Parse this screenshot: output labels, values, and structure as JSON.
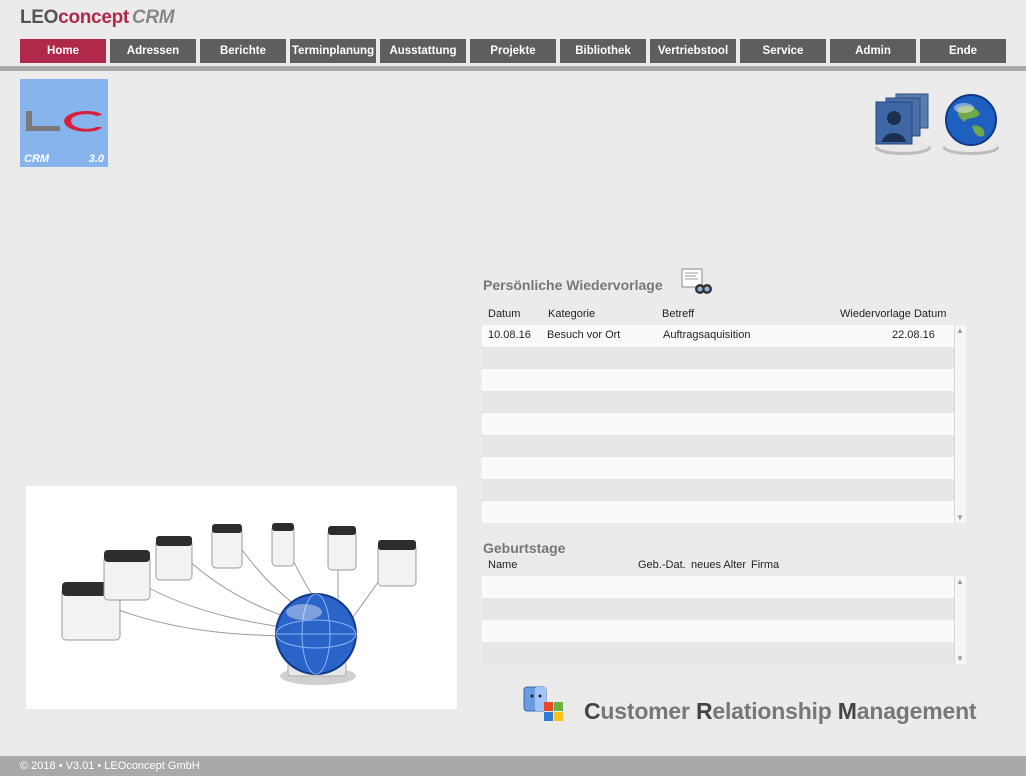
{
  "brand": {
    "part1": "LEO",
    "part2": "concept",
    "part3": "CRM"
  },
  "nav": [
    {
      "label": "Home",
      "active": true
    },
    {
      "label": "Adressen"
    },
    {
      "label": "Berichte"
    },
    {
      "label": "Terminplanung"
    },
    {
      "label": "Ausstattung"
    },
    {
      "label": "Projekte"
    },
    {
      "label": "Bibliothek"
    },
    {
      "label": "Vertriebstool"
    },
    {
      "label": "Service"
    },
    {
      "label": "Admin"
    },
    {
      "label": "Ende"
    }
  ],
  "logo": {
    "crm": "CRM",
    "version": "3.0"
  },
  "wiedervorlage": {
    "title": "Persönliche Wiedervorlage",
    "columns": {
      "datum": "Datum",
      "kategorie": "Kategorie",
      "betreff": "Betreff",
      "wv_datum": "Wiedervorlage Datum"
    },
    "rows": [
      {
        "datum": "10.08.16",
        "kategorie": "Besuch vor Ort",
        "betreff": "Auftragsaquisition",
        "wv_datum": "22.08.16"
      }
    ]
  },
  "geburtstage": {
    "title": "Geburtstage",
    "columns": {
      "name": "Name",
      "geb_dat": "Geb.-Dat.",
      "alter": "neues Alter",
      "firma": "Firma"
    }
  },
  "slogan": {
    "c": "C",
    "c_rest": "ustomer ",
    "r": "R",
    "r_rest": "elationship ",
    "m": "M",
    "m_rest": "anagement"
  },
  "footer": {
    "text": "© 2018 • V3.01 • LEOconcept GmbH"
  },
  "colors": {
    "accent": "#b0294a",
    "nav_bg": "#5e5e5e",
    "rule": "#a9a9a9",
    "page_bg": "#ebebeb"
  }
}
